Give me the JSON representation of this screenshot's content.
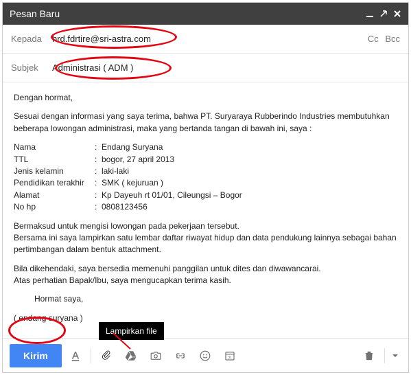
{
  "window": {
    "title": "Pesan Baru"
  },
  "fields": {
    "to_label": "Kepada",
    "to_value": "hrd.fdrtire@sri-astra.com",
    "cc": "Cc",
    "bcc": "Bcc",
    "subject_label": "Subjek",
    "subject_value": "Administrasi ( ADM )"
  },
  "body": {
    "greeting": "Dengan hormat,",
    "intro": "Sesuai dengan informasi yang saya terima, bahwa PT. Suryaraya Rubberindo Industries membutuhkan beberapa lowongan administrasi, maka yang bertanda tangan di bawah ini, saya :",
    "info": {
      "nama_k": "Nama",
      "nama_v": "Endang Suryana",
      "ttl_k": "TTL",
      "ttl_v": "bogor, 27 april 2013",
      "jk_k": "Jenis kelamin",
      "jk_v": "laki-laki",
      "pend_k": "Pendidikan terakhir",
      "pend_v": "SMK ( kejuruan )",
      "alamat_k": "Alamat",
      "alamat_v": "Kp Dayeuh rt 01/01, Cileungsi – Bogor",
      "hp_k": "No hp",
      "hp_v": "0808123456"
    },
    "p1": "Bermaksud untuk mengisi lowongan pada pekerjaan tersebut.",
    "p2": "Bersama ini saya lampirkan satu lembar daftar riwayat hidup dan data pendukung lainnya sebagai bahan pertimbangan dalam bentuk attachment.",
    "p3": "Bila dikehendaki, saya bersedia memenuhi panggilan untuk dites dan diwawancarai.",
    "p4": "Atas perhatian Bapak/Ibu, saya mengucapkan terima kasih.",
    "closing": "Hormat saya,",
    "signature": "( endang suryana )"
  },
  "toolbar": {
    "send": "Kirim",
    "attach_tooltip": "Lampirkan file"
  }
}
